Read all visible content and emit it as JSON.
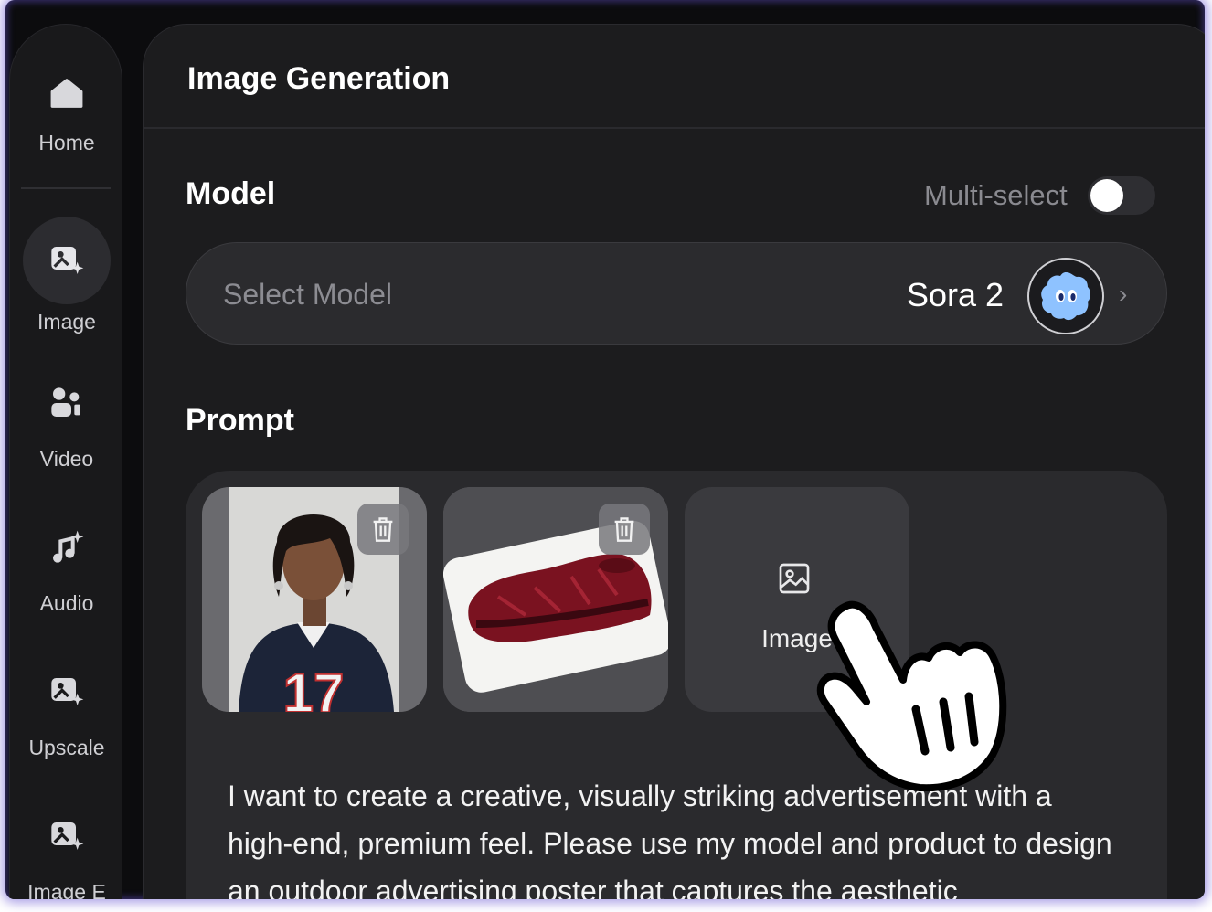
{
  "sidebar": {
    "items": [
      {
        "label": "Home",
        "icon": "home-icon"
      },
      {
        "label": "Image",
        "icon": "image-sparkle-icon",
        "active": true
      },
      {
        "label": "Video",
        "icon": "video-people-icon"
      },
      {
        "label": "Audio",
        "icon": "music-sparkle-icon"
      },
      {
        "label": "Upscale",
        "icon": "image-sparkle-icon"
      },
      {
        "label": "Image E",
        "icon": "image-sparkle-icon"
      }
    ]
  },
  "panel": {
    "title": "Image Generation",
    "model": {
      "label": "Model",
      "multi_select_label": "Multi-select",
      "multi_select_on": false,
      "select_placeholder": "Select Model",
      "selected_value": "Sora 2"
    },
    "prompt": {
      "label": "Prompt",
      "add_image_label": "Image",
      "text": "I want to create a creative, visually striking advertisement with a high-end, premium feel. Please use my model and product to design an outdoor advertising poster that captures the aesthetic"
    }
  },
  "colors": {
    "background": "#0c0c0e",
    "panel": "#1c1c1e",
    "accent_glow": "#624ed2"
  }
}
